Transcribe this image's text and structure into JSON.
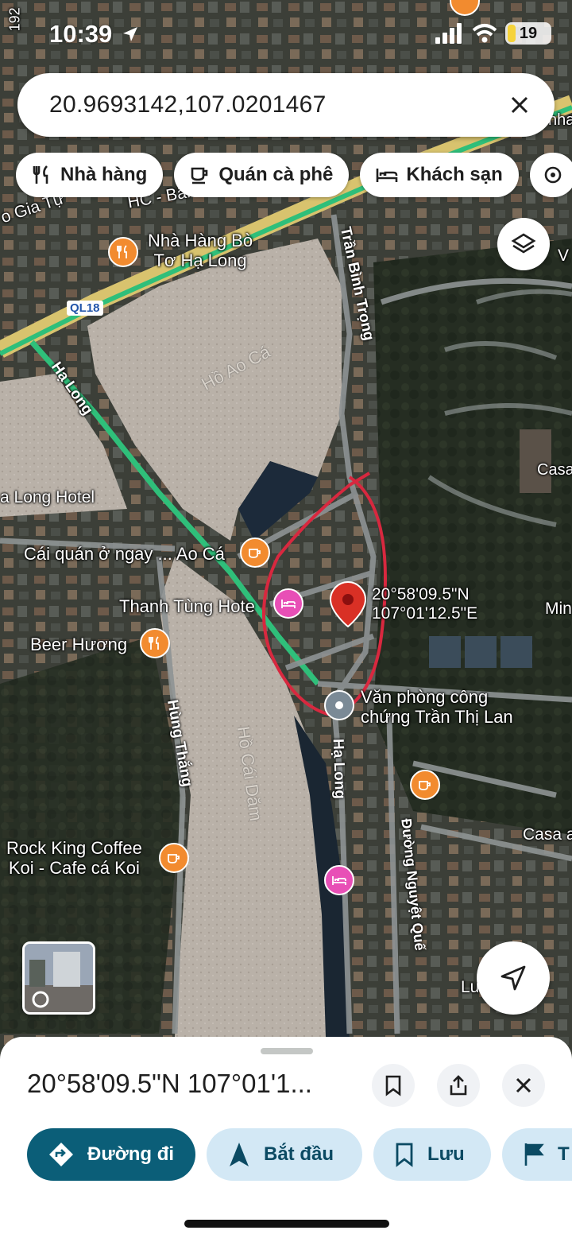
{
  "status_bar": {
    "time": "10:39",
    "battery": "19"
  },
  "search": {
    "query": "20.9693142,107.0201467"
  },
  "chips": [
    {
      "label": "Nhà hàng",
      "icon": "fork-knife-icon"
    },
    {
      "label": "Quán cà phê",
      "icon": "coffee-cup-icon"
    },
    {
      "label": "Khách sạn",
      "icon": "bed-icon"
    }
  ],
  "map": {
    "labels": {
      "nha_hang_bo": "Nhà Hàng Bò\nTơ Hạ Long",
      "hc_bai_chay": "HC - Bãi Cháy",
      "gia_tu": "o Gia Tự",
      "num_192": "192",
      "cai_quan": "Cái quán ở ngay ... Ao Cá",
      "thanh_tung": "Thanh Tùng Hote",
      "beer_huong": "Beer Hương",
      "long_hotel": "a Long Hotel",
      "van_phong": "Văn phòng công\nchứng Trần Thị Lan",
      "rock_king": "Rock King Coffee\nKoi - Cafe cá Koi",
      "coord_label": "20°58'09.5\"N\n107°01'12.5\"E",
      "casa_a": "Casa a",
      "casa_b": "Casa H",
      "min": "Min",
      "lu": "Lu",
      "v": "V",
      "nha": "nha",
      "ho_ao_ca": "Hồ Ao Cá",
      "ho_cai_dam": "Hồ Cái Dăm",
      "ql18": "QL18"
    },
    "streets": {
      "tran_binh_trong": "Trần Bình Trọng",
      "ha_long_1": "Hạ Long",
      "ha_long_2": "Hạ Long",
      "hung_thang": "Hùng Thắng",
      "nguyet_que": "Đường Nguyệt Quế"
    }
  },
  "sheet": {
    "title": "20°58'09.5\"N 107°01'1...",
    "actions": [
      {
        "label": "Đường đi"
      },
      {
        "label": "Bắt đầu"
      },
      {
        "label": "Lưu"
      },
      {
        "label": "T"
      }
    ]
  },
  "colors": {
    "primary": "#0b5e78",
    "tonal": "#d3e8f5",
    "pin": "#d93025",
    "annotation": "#d8283f"
  }
}
